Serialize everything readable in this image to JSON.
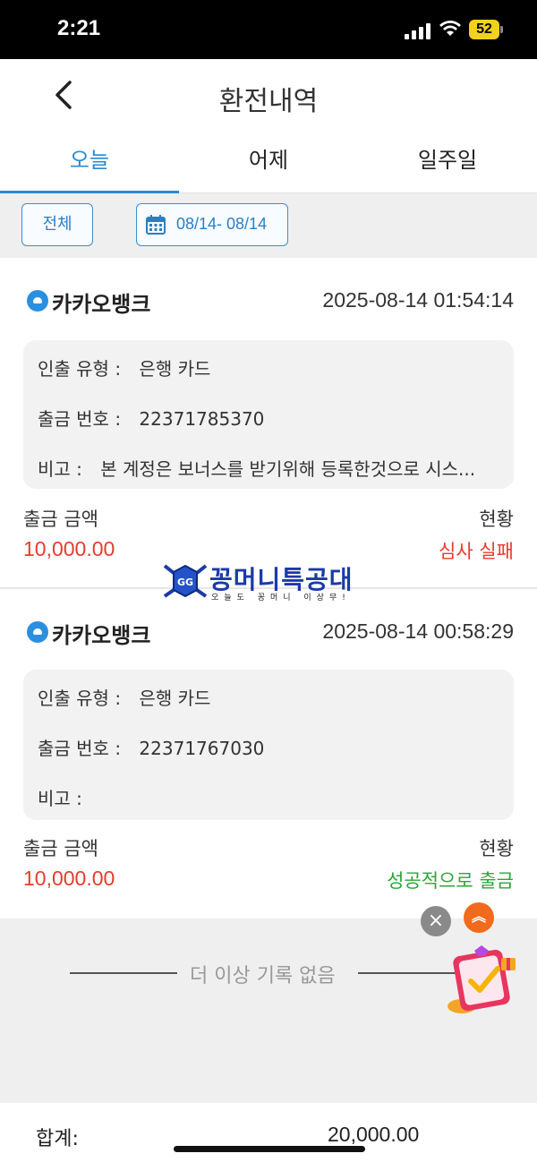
{
  "status_bar": {
    "time": "2:21",
    "battery": "52"
  },
  "header": {
    "title": "환전내역"
  },
  "tabs": [
    {
      "label": "오늘",
      "active": true
    },
    {
      "label": "어제",
      "active": false
    },
    {
      "label": "일주일",
      "active": false
    }
  ],
  "filter": {
    "all_label": "전체",
    "date_range": "08/14- 08/14"
  },
  "transactions": [
    {
      "bank": "카카오뱅크",
      "datetime": "2025-08-14 01:54:14",
      "type_label": "인출 유형 :",
      "type_value": "은행 카드",
      "number_label": "출금 번호 :",
      "number_value": "22371785370",
      "note_label": "비고 :",
      "note_value": "본 계정은 보너스를 받기위해 등록한것으로 시스...",
      "amount_label": "출금 금액",
      "amount_value": "10,000.00",
      "status_label": "현황",
      "status_value": "심사 실패",
      "status_color": "#e63c2f"
    },
    {
      "bank": "카카오뱅크",
      "datetime": "2025-08-14 00:58:29",
      "type_label": "인출 유형 :",
      "type_value": "은행 카드",
      "number_label": "출금 번호 :",
      "number_value": "22371767030",
      "note_label": "비고 :",
      "note_value": "",
      "amount_label": "출금 금액",
      "amount_value": "10,000.00",
      "status_label": "현황",
      "status_value": "성공적으로 출금",
      "status_color": "#2aa63a"
    }
  ],
  "watermark": {
    "title": "꽁머니특공대",
    "subtitle": "오늘도 꽁머니 이상무!"
  },
  "end_message": "더 이상 기록 없음",
  "footer": {
    "total_label": "합계:",
    "total_value": "20,000.00"
  },
  "colors": {
    "accent": "#2a8ad4",
    "fail": "#e63c2f",
    "success": "#2aa63a"
  },
  "icons": [
    "back-icon",
    "calendar-icon",
    "kakaobank-icon",
    "close-icon",
    "scroll-top-icon",
    "gift-icon"
  ]
}
